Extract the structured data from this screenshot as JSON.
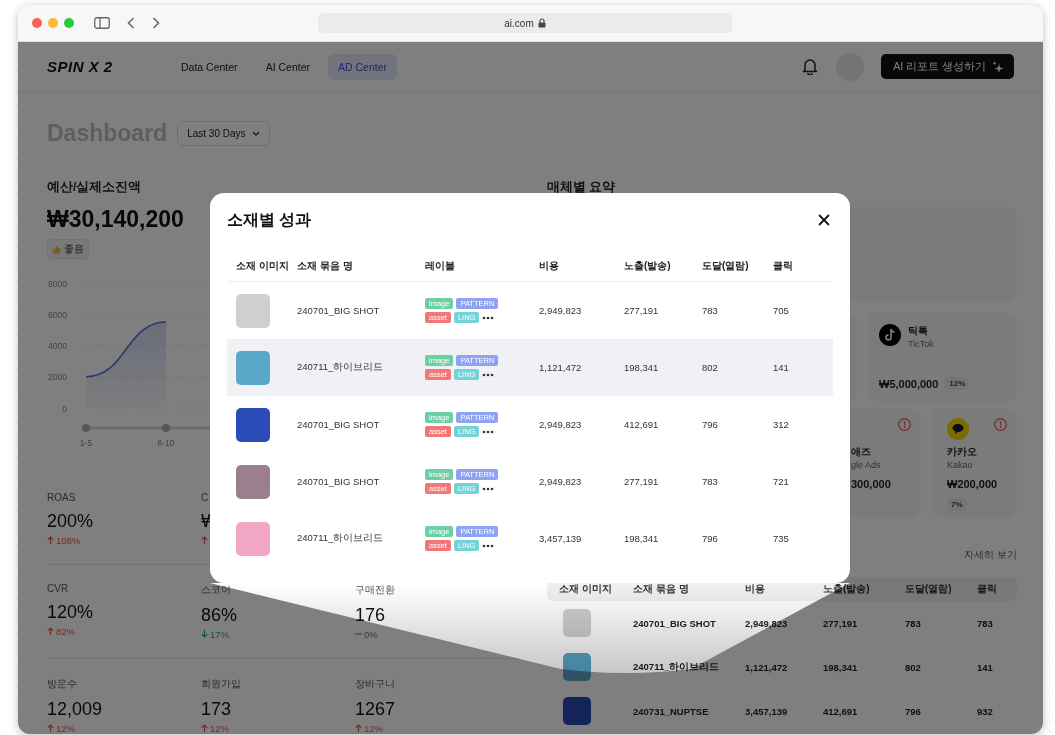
{
  "browser": {
    "url": "ai.com"
  },
  "header": {
    "logo": "SPIN X 2",
    "nav": [
      {
        "label": "Data Center",
        "selected": false
      },
      {
        "label": "AI Center",
        "selected": false
      },
      {
        "label": "AD Center",
        "selected": true
      }
    ],
    "cta": "AI 리포트 생성하기"
  },
  "dashboard": {
    "title": "Dashboard",
    "range": "Last 30 Days"
  },
  "budget": {
    "title": "예산/실제소진액",
    "amount": "₩30,140,200",
    "badge": "좋음",
    "chart_data": {
      "type": "area",
      "grid": true,
      "x": [
        "1-5",
        "6-10"
      ],
      "ylim": [
        0,
        8000
      ],
      "yticks": [
        0,
        2000,
        4000,
        6000,
        8000
      ],
      "series": [
        {
          "color": "#5b6bd6",
          "values": [
            2000,
            5500
          ]
        }
      ]
    }
  },
  "metric_rows": [
    [
      {
        "label": "ROAS",
        "value": "200%",
        "change": "108%",
        "kind": "up"
      },
      {
        "label": "C",
        "value": "₩",
        "kind": "up"
      }
    ],
    [
      {
        "label": "CVR",
        "value": "120%",
        "change": "82%",
        "kind": "up"
      },
      {
        "label": "스코어",
        "value": "86%",
        "change": "17%",
        "kind": "down"
      },
      {
        "label": "구매전환",
        "value": "176",
        "change": "0%",
        "kind": "flat"
      }
    ],
    [
      {
        "label": "방문수",
        "value": "12,009",
        "change": "12%",
        "kind": "up"
      },
      {
        "label": "회원가입",
        "value": "173",
        "change": "12%",
        "kind": "up"
      },
      {
        "label": "장바구니",
        "value": "1267",
        "change": "12%",
        "kind": "up"
      }
    ]
  ],
  "media": {
    "title": "매체별 요약",
    "featured": [
      {
        "kind": "tiktok",
        "name": "틱톡",
        "subtitle": "TicTok",
        "amount": "₩5,000,000",
        "share": "12%"
      }
    ],
    "channels": [
      {
        "kind": "google",
        "name": "애즈",
        "subtitle": "gle Ads",
        "amount": "300,000",
        "alert": true
      },
      {
        "kind": "kakao",
        "name": "카카오",
        "subtitle": "Kakao",
        "amount": "₩200,000",
        "share": "7%",
        "alert": true
      }
    ],
    "more": "자세히 보기"
  },
  "creative_table": {
    "columns": [
      "소재 이미지",
      "소재 묶음 명",
      "비용",
      "노출(발송)",
      "도달(열람)",
      "클릭"
    ],
    "rows": [
      {
        "name": "240701_BIG SHOT",
        "cost": "2,949,823",
        "exposure": "277,191",
        "reach": "783",
        "clicks": "783"
      },
      {
        "name": "240711_하이브리드",
        "cost": "1,121,472",
        "exposure": "198,341",
        "reach": "802",
        "clicks": "141"
      },
      {
        "name": "240731_NUPTSE",
        "cost": "3,457,139",
        "exposure": "412,691",
        "reach": "796",
        "clicks": "932"
      }
    ]
  },
  "modal": {
    "title": "소재별 성과",
    "columns": [
      "소재 이미지",
      "소재 묶음 명",
      "레이블",
      "비용",
      "노출(발송)",
      "도달(열람)",
      "클릭"
    ],
    "rows": [
      {
        "name": "240701_BIG SHOT",
        "labels": [
          {
            "text": "image",
            "color": "#6dcfa3"
          },
          {
            "text": "PATTERN",
            "color": "#8ea3f2"
          },
          {
            "text": "asset",
            "color": "#f27878"
          },
          {
            "text": "LING",
            "color": "#72d3d8"
          }
        ],
        "cost": "2,949,823",
        "exposure": "277,191",
        "reach": "783",
        "clicks": "705",
        "selected": false
      },
      {
        "name": "240711_하이브리드",
        "labels": [
          {
            "text": "image",
            "color": "#6dcfa3"
          },
          {
            "text": "PATTERN",
            "color": "#8ea3f2"
          },
          {
            "text": "asset",
            "color": "#f27878"
          },
          {
            "text": "LING",
            "color": "#72d3d8"
          }
        ],
        "cost": "1,121,472",
        "exposure": "198,341",
        "reach": "802",
        "clicks": "141",
        "selected": true
      },
      {
        "name": "240701_BIG SHOT",
        "labels": [
          {
            "text": "image",
            "color": "#6dcfa3"
          },
          {
            "text": "PATTERN",
            "color": "#8ea3f2"
          },
          {
            "text": "asset",
            "color": "#f27878"
          },
          {
            "text": "LING",
            "color": "#72d3d8"
          }
        ],
        "cost": "2,949,823",
        "exposure": "412,691",
        "reach": "796",
        "clicks": "312",
        "selected": false
      },
      {
        "name": "240701_BIG SHOT",
        "labels": [
          {
            "text": "image",
            "color": "#6dcfa3"
          },
          {
            "text": "PATTERN",
            "color": "#8ea3f2"
          },
          {
            "text": "asset",
            "color": "#f27878"
          },
          {
            "text": "LING",
            "color": "#72d3d8"
          }
        ],
        "cost": "2,949,823",
        "exposure": "277,191",
        "reach": "783",
        "clicks": "721",
        "selected": false
      },
      {
        "name": "240711_하이브리드",
        "labels": [
          {
            "text": "image",
            "color": "#6dcfa3"
          },
          {
            "text": "PATTERN",
            "color": "#8ea3f2"
          },
          {
            "text": "asset",
            "color": "#f27878"
          },
          {
            "text": "LING",
            "color": "#72d3d8"
          }
        ],
        "cost": "3,457,139",
        "exposure": "198,341",
        "reach": "796",
        "clicks": "735",
        "selected": false
      }
    ]
  }
}
